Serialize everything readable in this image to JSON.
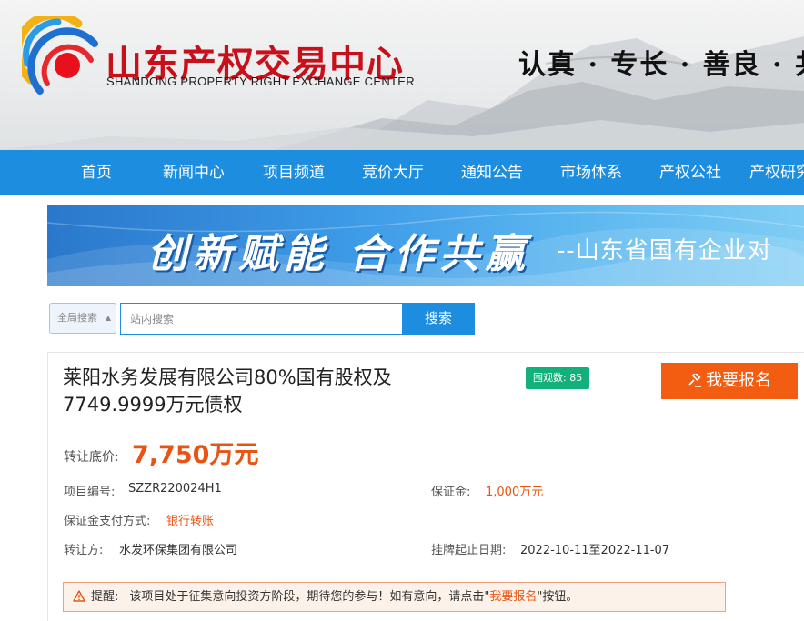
{
  "header": {
    "logo_cn": "山东产权交易中心",
    "logo_en": "SHANDONG PROPERTY RIGHT EXCHANGE CENTER",
    "slogan": "认真 · 专长 · 善良 · 共"
  },
  "nav": {
    "items": [
      "首页",
      "新闻中心",
      "项目频道",
      "竞价大厅",
      "通知公告",
      "市场体系",
      "产权公社",
      "产权研究"
    ]
  },
  "banner": {
    "calligraphy": "创新赋能 合作共赢",
    "subtitle": "--山东省国有企业对"
  },
  "search": {
    "scope": "全局搜索",
    "placeholder": "站内搜索",
    "value": "",
    "button_label": "搜索"
  },
  "project": {
    "title": "莱阳水务发展有限公司80%国有股权及7749.9999万元债权",
    "views_label": "围观数:",
    "views_count": "85",
    "signup_label": "我要报名",
    "price_label": "转让底价:",
    "price_value": "7,750万元",
    "fields": {
      "project_no_label": "项目编号:",
      "project_no": "SZZR220024H1",
      "deposit_label": "保证金:",
      "deposit": "1,000万元",
      "payment_label": "保证金支付方式:",
      "payment": "银行转账",
      "transferor_label": "转让方:",
      "transferor": "水发环保集团有限公司",
      "date_label": "挂牌起止日期:",
      "date_range": "2022-10-11至2022-11-07"
    },
    "notice": {
      "label": "提醒:",
      "text_before": "该项目处于征集意向投资方阶段，期待您的参与！如有意向，请点击\"",
      "link": "我要报名",
      "text_after": "\"按钮。"
    }
  },
  "colors": {
    "nav_blue": "#1d8ddf",
    "accent_orange": "#ea5413",
    "button_orange": "#f25d12",
    "badge_green": "#12b07a",
    "logo_red": "#c8101a"
  },
  "icons": [
    "logo-icon",
    "chevron-updown-icon",
    "gavel-icon",
    "warning-icon"
  ]
}
